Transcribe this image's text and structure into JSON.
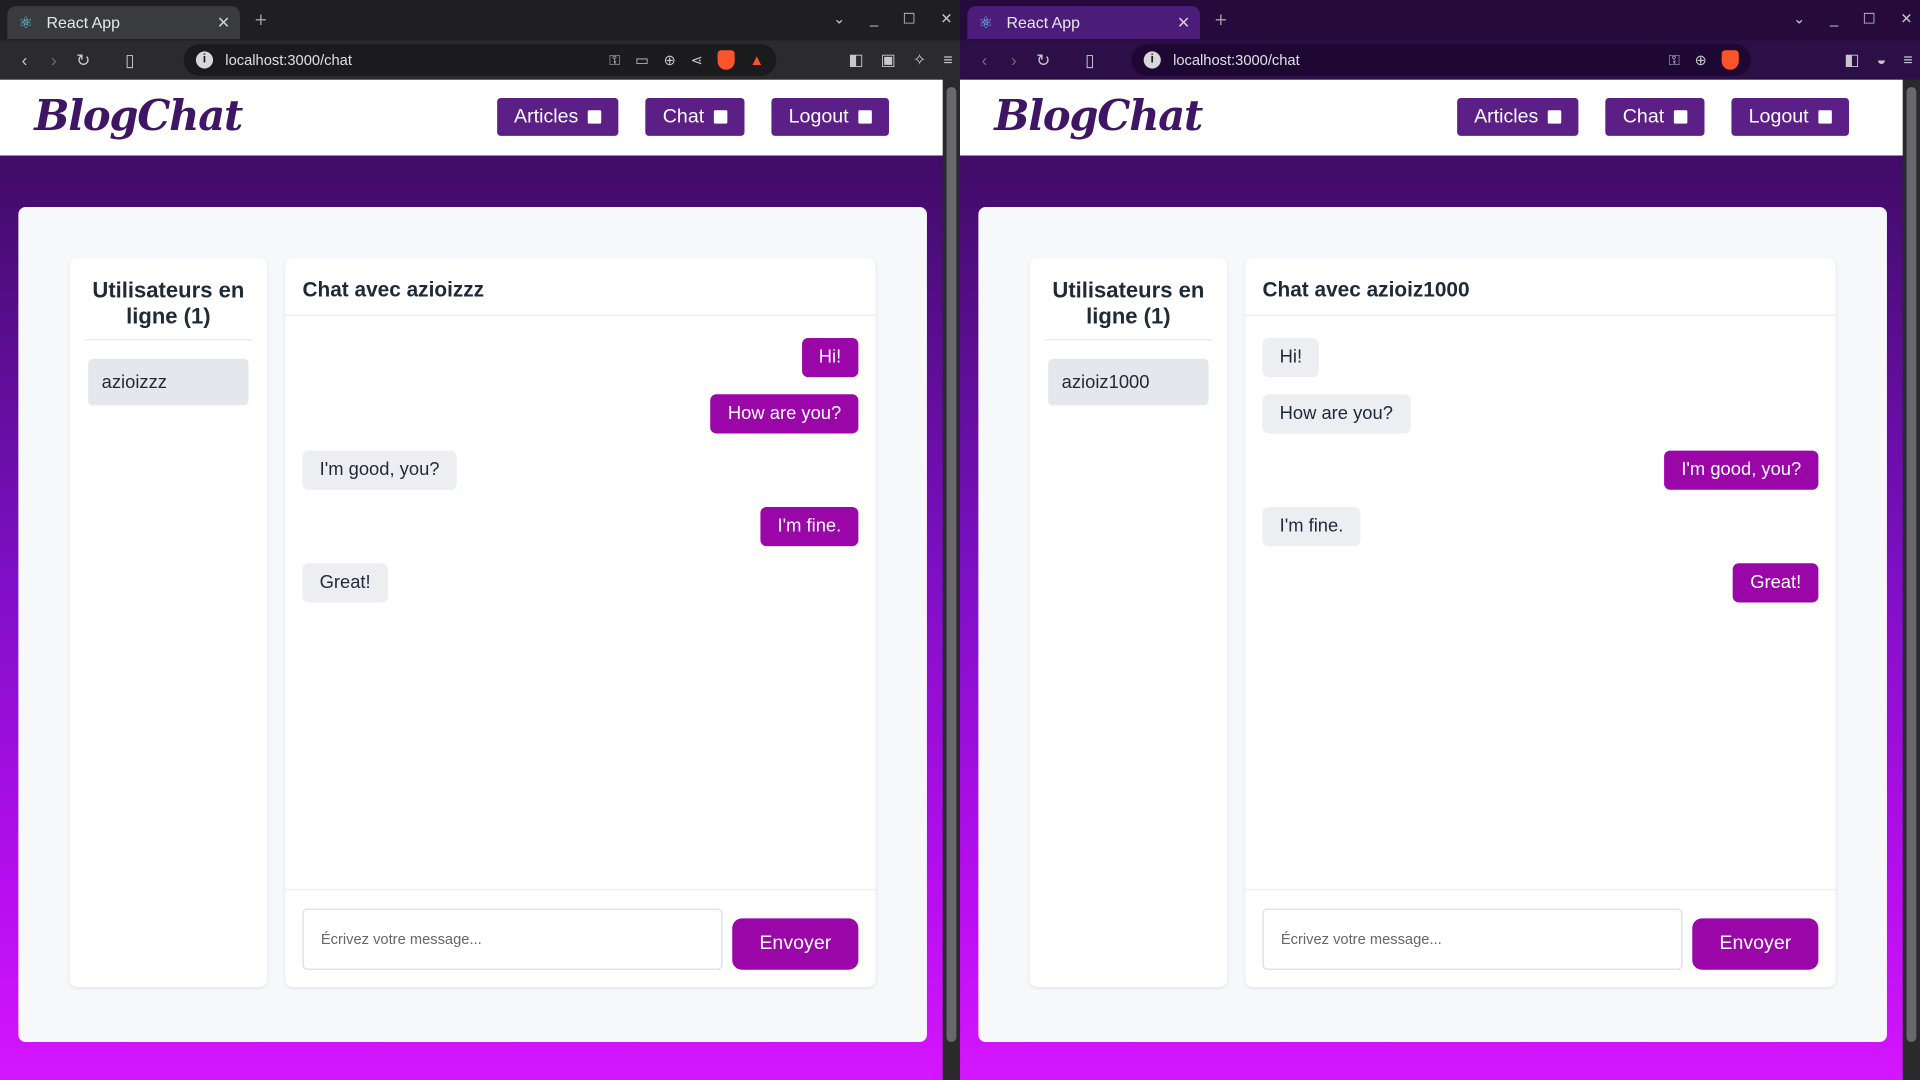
{
  "windows": [
    {
      "tab_title": "React App",
      "url": "localhost:3000/chat",
      "app": {
        "logo": "BlogChat",
        "nav": {
          "articles": "Articles",
          "chat": "Chat",
          "logout": "Logout"
        },
        "users_title": "Utilisateurs en ligne (1)",
        "users": [
          "azioizzz"
        ],
        "chat_title": "Chat avec azioizzz",
        "messages": [
          {
            "text": "Hi!",
            "mine": true
          },
          {
            "text": "How are you?",
            "mine": true
          },
          {
            "text": "I'm good, you?",
            "mine": false
          },
          {
            "text": "I'm fine.",
            "mine": true
          },
          {
            "text": "Great!",
            "mine": false
          }
        ],
        "input_placeholder": "Écrivez votre message...",
        "send_label": "Envoyer"
      }
    },
    {
      "tab_title": "React App",
      "url": "localhost:3000/chat",
      "app": {
        "logo": "BlogChat",
        "nav": {
          "articles": "Articles",
          "chat": "Chat",
          "logout": "Logout"
        },
        "users_title": "Utilisateurs en ligne (1)",
        "users": [
          "azioiz1000"
        ],
        "chat_title": "Chat avec azioiz1000",
        "messages": [
          {
            "text": "Hi!",
            "mine": false
          },
          {
            "text": "How are you?",
            "mine": false
          },
          {
            "text": "I'm good, you?",
            "mine": true
          },
          {
            "text": "I'm fine.",
            "mine": false
          },
          {
            "text": "Great!",
            "mine": true
          }
        ],
        "input_placeholder": "Écrivez votre message...",
        "send_label": "Envoyer"
      }
    }
  ],
  "colors": {
    "accent": "#9a06a8",
    "nav_button": "#5c1f86",
    "logo": "#3e1663"
  }
}
